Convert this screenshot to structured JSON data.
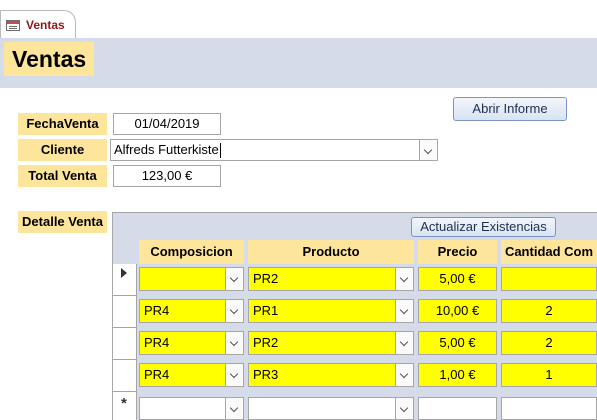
{
  "tab": {
    "label": "Ventas"
  },
  "form": {
    "title": "Ventas",
    "open_report_button": "Abrir Informe",
    "fecha_label": "FechaVenta",
    "fecha_value": "01/04/2019",
    "cliente_label": "Cliente",
    "cliente_value": "Alfreds Futterkiste",
    "total_label": "Total Venta",
    "total_value": "123,00 €",
    "detalle_label": "Detalle Venta"
  },
  "subform": {
    "update_button": "Actualizar Existencias",
    "columns": [
      "Composicion",
      "Producto",
      "Precio",
      "Cantidad Com"
    ],
    "rows": [
      {
        "composicion": "",
        "producto": "PR2",
        "precio": "5,00 €",
        "cantidad": ""
      },
      {
        "composicion": "PR4",
        "producto": "PR1",
        "precio": "10,00 €",
        "cantidad": "2"
      },
      {
        "composicion": "PR4",
        "producto": "PR2",
        "precio": "5,00 €",
        "cantidad": "2"
      },
      {
        "composicion": "PR4",
        "producto": "PR3",
        "precio": "1,00 €",
        "cantidad": "1"
      },
      {
        "composicion": "",
        "producto": "",
        "precio": "",
        "cantidad": ""
      }
    ]
  },
  "colors": {
    "label_bg": "#fee59c",
    "header_bg": "#d6dbe9",
    "cell_highlight": "#ffff00"
  },
  "icons": [
    "form-icon",
    "current-record-arrow-icon",
    "new-record-asterisk-icon",
    "dropdown-arrow-icon"
  ]
}
